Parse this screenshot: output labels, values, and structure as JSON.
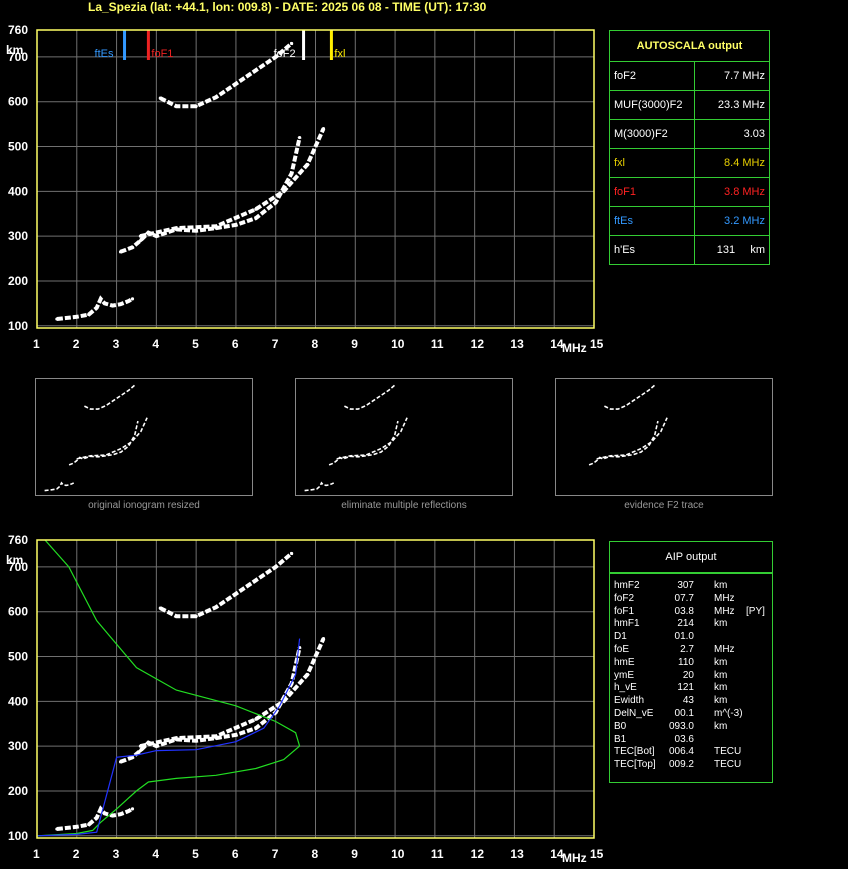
{
  "header": "La_Spezia (lat: +44.1, lon: 009.8) - DATE: 2025 06 08 - TIME (UT): 17:30",
  "axes": {
    "ylabel": "km",
    "xlabel": "MHz",
    "x_ticks": [
      "1",
      "2",
      "3",
      "4",
      "5",
      "6",
      "7",
      "8",
      "9",
      "10",
      "11",
      "12",
      "13",
      "14",
      "15"
    ],
    "y_ticks_top": [
      "760",
      "700",
      "600",
      "500",
      "400",
      "300",
      "200",
      "100"
    ],
    "y_ticks_bottom": [
      "760",
      "700",
      "600",
      "500",
      "400",
      "300",
      "200",
      "100"
    ]
  },
  "markers": [
    {
      "label": "ftEs",
      "freq": 3.2,
      "color": "#3399ff"
    },
    {
      "label": "foF1",
      "freq": 3.8,
      "color": "#ee2222"
    },
    {
      "label": "foF2",
      "freq": 7.7,
      "color": "#ffffff"
    },
    {
      "label": "fxl",
      "freq": 8.4,
      "color": "#ffee00"
    }
  ],
  "autoscala": {
    "title": "AUTOSCALA output",
    "rows": [
      {
        "label": "foF2",
        "value": "7.7 MHz",
        "color": "#ffffff"
      },
      {
        "label": "MUF(3000)F2",
        "value": "23.3 MHz",
        "color": "#ffffff"
      },
      {
        "label": "M(3000)F2",
        "value": "3.03",
        "color": "#ffffff"
      },
      {
        "label": "fxl",
        "value": "8.4 MHz",
        "color": "#e8d000"
      },
      {
        "label": "foF1",
        "value": "3.8 MHz",
        "color": "#ff2222"
      },
      {
        "label": "ftEs",
        "value": "3.2 MHz",
        "color": "#3399ff"
      },
      {
        "label": "h'Es",
        "value": "131",
        "unit": "km",
        "color": "#ffffff"
      }
    ]
  },
  "thumbnails": [
    {
      "caption": "original ionogram resized"
    },
    {
      "caption": "eliminate multiple reflections"
    },
    {
      "caption": "evidence F2 trace"
    }
  ],
  "aip": {
    "title": "AIP output",
    "rows": [
      {
        "name": "hmF2",
        "value": "307",
        "unit": "km",
        "flag": ""
      },
      {
        "name": "foF2",
        "value": "07.7",
        "unit": "MHz",
        "flag": ""
      },
      {
        "name": "foF1",
        "value": "03.8",
        "unit": "MHz",
        "flag": "[PY]"
      },
      {
        "name": "hmF1",
        "value": "214",
        "unit": "km",
        "flag": ""
      },
      {
        "name": "D1",
        "value": "01.0",
        "unit": "",
        "flag": ""
      },
      {
        "name": "foE",
        "value": "2.7",
        "unit": "MHz",
        "flag": ""
      },
      {
        "name": "hmE",
        "value": "110",
        "unit": "km",
        "flag": ""
      },
      {
        "name": "ymE",
        "value": "20",
        "unit": "km",
        "flag": ""
      },
      {
        "name": "h_vE",
        "value": "121",
        "unit": "km",
        "flag": ""
      },
      {
        "name": "Ewidth",
        "value": "43",
        "unit": "km",
        "flag": ""
      },
      {
        "name": "DelN_vE",
        "value": "00.1",
        "unit": "m^(-3)",
        "flag": ""
      },
      {
        "name": "B0",
        "value": "093.0",
        "unit": "km",
        "flag": ""
      },
      {
        "name": "B1",
        "value": "03.6",
        "unit": "",
        "flag": ""
      },
      {
        "name": "TEC[Bot]",
        "value": "006.4",
        "unit": "TECU",
        "flag": ""
      },
      {
        "name": "TEC[Top]",
        "value": "009.2",
        "unit": "TECU",
        "flag": ""
      }
    ]
  },
  "chart_data": [
    {
      "type": "scatter",
      "title": "",
      "xlabel": "MHz",
      "ylabel": "km",
      "xlim": [
        1,
        15
      ],
      "ylim": [
        95,
        760
      ],
      "grid": true,
      "series": [
        {
          "values": [
            [
              1.5,
              115
            ],
            [
              2.0,
              120
            ],
            [
              2.3,
              125
            ],
            [
              2.5,
              140
            ],
            [
              2.6,
              160
            ],
            [
              2.7,
              150
            ],
            [
              2.9,
              145
            ],
            [
              3.1,
              148
            ],
            [
              3.3,
              155
            ],
            [
              3.4,
              160
            ]
          ]
        },
        {
          "values": [
            [
              3.1,
              265
            ],
            [
              3.4,
              275
            ],
            [
              3.6,
              290
            ],
            [
              3.8,
              308
            ],
            [
              4.0,
              300
            ],
            [
              4.5,
              315
            ],
            [
              5.0,
              312
            ],
            [
              5.5,
              318
            ],
            [
              6.0,
              325
            ],
            [
              6.5,
              340
            ],
            [
              7.0,
              375
            ],
            [
              7.4,
              440
            ],
            [
              7.6,
              520
            ]
          ]
        },
        {
          "values": [
            [
              3.6,
              300
            ],
            [
              4.5,
              318
            ],
            [
              5.5,
              322
            ],
            [
              6.5,
              360
            ],
            [
              7.2,
              400
            ],
            [
              7.8,
              460
            ],
            [
              8.2,
              540
            ]
          ]
        },
        {
          "values": [
            [
              4.1,
              608
            ],
            [
              4.5,
              590
            ],
            [
              5.0,
              590
            ],
            [
              5.5,
              610
            ],
            [
              6.0,
              640
            ],
            [
              6.5,
              670
            ],
            [
              7.0,
              700
            ],
            [
              7.4,
              730
            ]
          ]
        }
      ]
    },
    {
      "type": "line",
      "title": "",
      "xlabel": "MHz",
      "ylabel": "km",
      "xlim": [
        1,
        15
      ],
      "ylim": [
        95,
        760
      ],
      "grid": true,
      "series": [
        {
          "color": "#22dd22",
          "values": [
            [
              1.0,
              100
            ],
            [
              2.0,
              105
            ],
            [
              2.4,
              112
            ],
            [
              2.6,
              130
            ],
            [
              3.0,
              160
            ],
            [
              3.5,
              200
            ],
            [
              3.8,
              220
            ],
            [
              4.5,
              228
            ],
            [
              5.5,
              235
            ],
            [
              6.5,
              250
            ],
            [
              7.2,
              270
            ],
            [
              7.6,
              300
            ],
            [
              7.5,
              330
            ],
            [
              7.0,
              355
            ],
            [
              6.0,
              390
            ],
            [
              4.5,
              425
            ],
            [
              3.5,
              475
            ],
            [
              2.5,
              580
            ],
            [
              1.8,
              700
            ],
            [
              1.2,
              760
            ]
          ]
        },
        {
          "color": "#2233ff",
          "values": [
            [
              1.0,
              100
            ],
            [
              2.0,
              103
            ],
            [
              2.5,
              108
            ],
            [
              3.0,
              275
            ],
            [
              3.5,
              280
            ],
            [
              4.0,
              290
            ],
            [
              5.0,
              292
            ],
            [
              6.0,
              310
            ],
            [
              6.7,
              340
            ],
            [
              7.1,
              390
            ],
            [
              7.5,
              460
            ],
            [
              7.6,
              540
            ]
          ]
        }
      ]
    }
  ]
}
